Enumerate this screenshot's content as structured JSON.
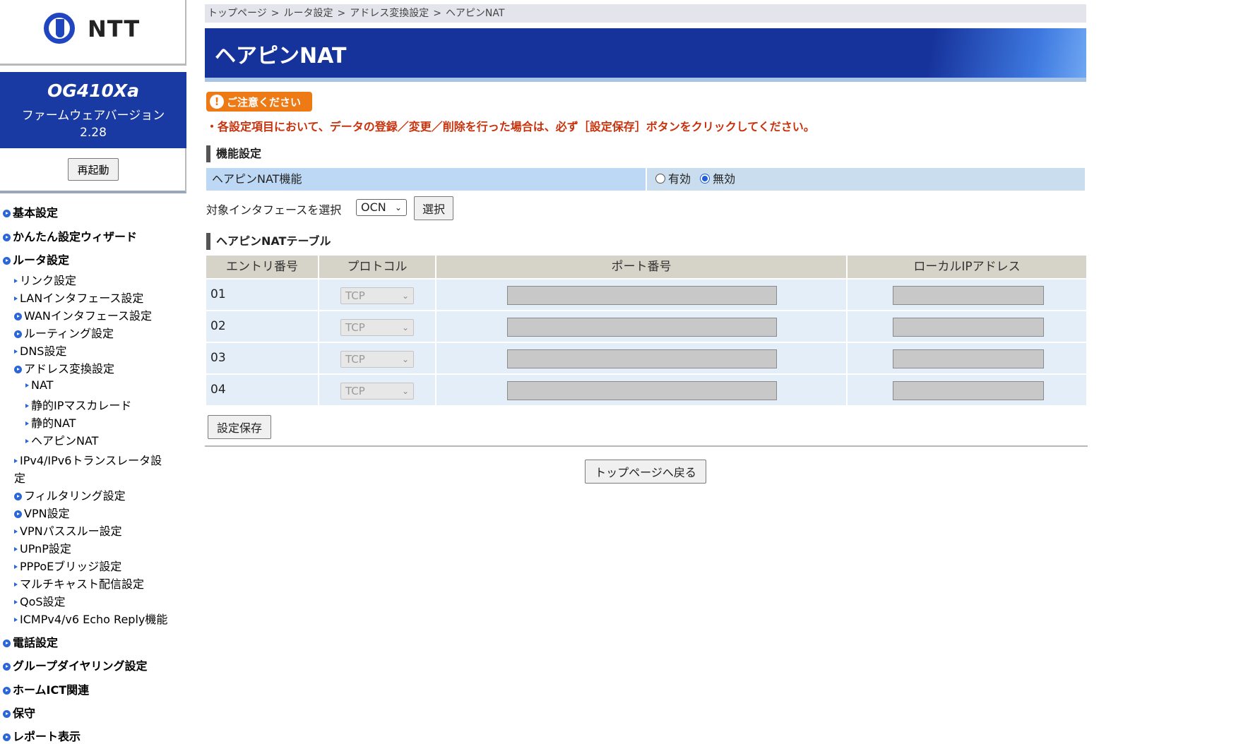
{
  "logo": {
    "text": "NTT"
  },
  "device": {
    "model": "OG410Xa",
    "firmware_label": "ファームウェアバージョン",
    "firmware_version": "2.28"
  },
  "sidebar": {
    "restart_label": "再起動",
    "nav": [
      {
        "label": "基本設定",
        "level": 0,
        "icon": "circle-arrow-icon"
      },
      {
        "label": "かんたん設定ウィザード",
        "level": 0,
        "icon": "circle-arrow-icon"
      },
      {
        "label": "ルータ設定",
        "level": 0,
        "icon": "circle-arrow-icon"
      },
      {
        "label": "リンク設定",
        "level": 1,
        "icon": "triangle-icon"
      },
      {
        "label": "LANインタフェース設定",
        "level": 1,
        "icon": "triangle-icon"
      },
      {
        "label": "WANインタフェース設定",
        "level": 1,
        "icon": "circle-arrow-icon"
      },
      {
        "label": "ルーティング設定",
        "level": 1,
        "icon": "circle-arrow-icon"
      },
      {
        "label": "DNS設定",
        "level": 1,
        "icon": "triangle-icon"
      },
      {
        "label": "アドレス変換設定",
        "level": 1,
        "icon": "circle-arrow-icon"
      },
      {
        "label": "NAT",
        "level": 2,
        "icon": "triangle-icon"
      },
      {
        "label": "静的IPマスカレード",
        "level": 2,
        "icon": "triangle-icon"
      },
      {
        "label": "静的NAT",
        "level": 2,
        "icon": "triangle-icon"
      },
      {
        "label": "ヘアピンNAT",
        "level": 2,
        "icon": "triangle-icon"
      },
      {
        "label": "IPv4/IPv6トランスレータ設",
        "level": 1,
        "icon": "triangle-icon"
      },
      {
        "label": "定",
        "level": 1,
        "icon": ""
      },
      {
        "label": "フィルタリング設定",
        "level": 1,
        "icon": "circle-arrow-icon"
      },
      {
        "label": "VPN設定",
        "level": 1,
        "icon": "circle-arrow-icon"
      },
      {
        "label": "VPNパススルー設定",
        "level": 1,
        "icon": "triangle-icon"
      },
      {
        "label": "UPnP設定",
        "level": 1,
        "icon": "triangle-icon"
      },
      {
        "label": "PPPoEブリッジ設定",
        "level": 1,
        "icon": "triangle-icon"
      },
      {
        "label": "マルチキャスト配信設定",
        "level": 1,
        "icon": "triangle-icon"
      },
      {
        "label": "QoS設定",
        "level": 1,
        "icon": "triangle-icon"
      },
      {
        "label": "ICMPv4/v6 Echo Reply機能",
        "level": 1,
        "icon": "triangle-icon"
      },
      {
        "label": "電話設定",
        "level": 0,
        "icon": "circle-arrow-icon"
      },
      {
        "label": "グループダイヤリング設定",
        "level": 0,
        "icon": "circle-arrow-icon"
      },
      {
        "label": "ホームICT関連",
        "level": 0,
        "icon": "circle-arrow-icon"
      },
      {
        "label": "保守",
        "level": 0,
        "icon": "circle-arrow-icon"
      },
      {
        "label": "レポート表示",
        "level": 0,
        "icon": "circle-arrow-icon"
      }
    ]
  },
  "breadcrumb": [
    "トップページ",
    "ルータ設定",
    "アドレス変換設定",
    "ヘアピンNAT"
  ],
  "breadcrumb_separator": ">",
  "page": {
    "title": "ヘアピンNAT"
  },
  "caution": {
    "badge": "ご注意ください",
    "text": "・各設定項目において、データの登録／変更／削除を行った場合は、必ず［設定保存］ボタンをクリックしてください。"
  },
  "function_settings": {
    "section_title": "機能設定",
    "label": "ヘアピンNAT機能",
    "options": [
      "有効",
      "無効"
    ],
    "selected": "無効"
  },
  "interface": {
    "label": "対象インタフェースを選択",
    "selected": "OCN",
    "button": "選択"
  },
  "table": {
    "section_title": "ヘアピンNATテーブル",
    "headers": [
      "エントリ番号",
      "プロトコル",
      "ポート番号",
      "ローカルIPアドレス"
    ],
    "rows": [
      {
        "entry": "01",
        "protocol": "TCP",
        "port": "",
        "ip": ""
      },
      {
        "entry": "02",
        "protocol": "TCP",
        "port": "",
        "ip": ""
      },
      {
        "entry": "03",
        "protocol": "TCP",
        "port": "",
        "ip": ""
      },
      {
        "entry": "04",
        "protocol": "TCP",
        "port": "",
        "ip": ""
      }
    ]
  },
  "buttons": {
    "save": "設定保存",
    "back_to_top": "トップページへ戻る"
  },
  "colors": {
    "brand_blue": "#16339b",
    "caution_orange": "#ee7a16",
    "caution_text": "#c8320c"
  }
}
